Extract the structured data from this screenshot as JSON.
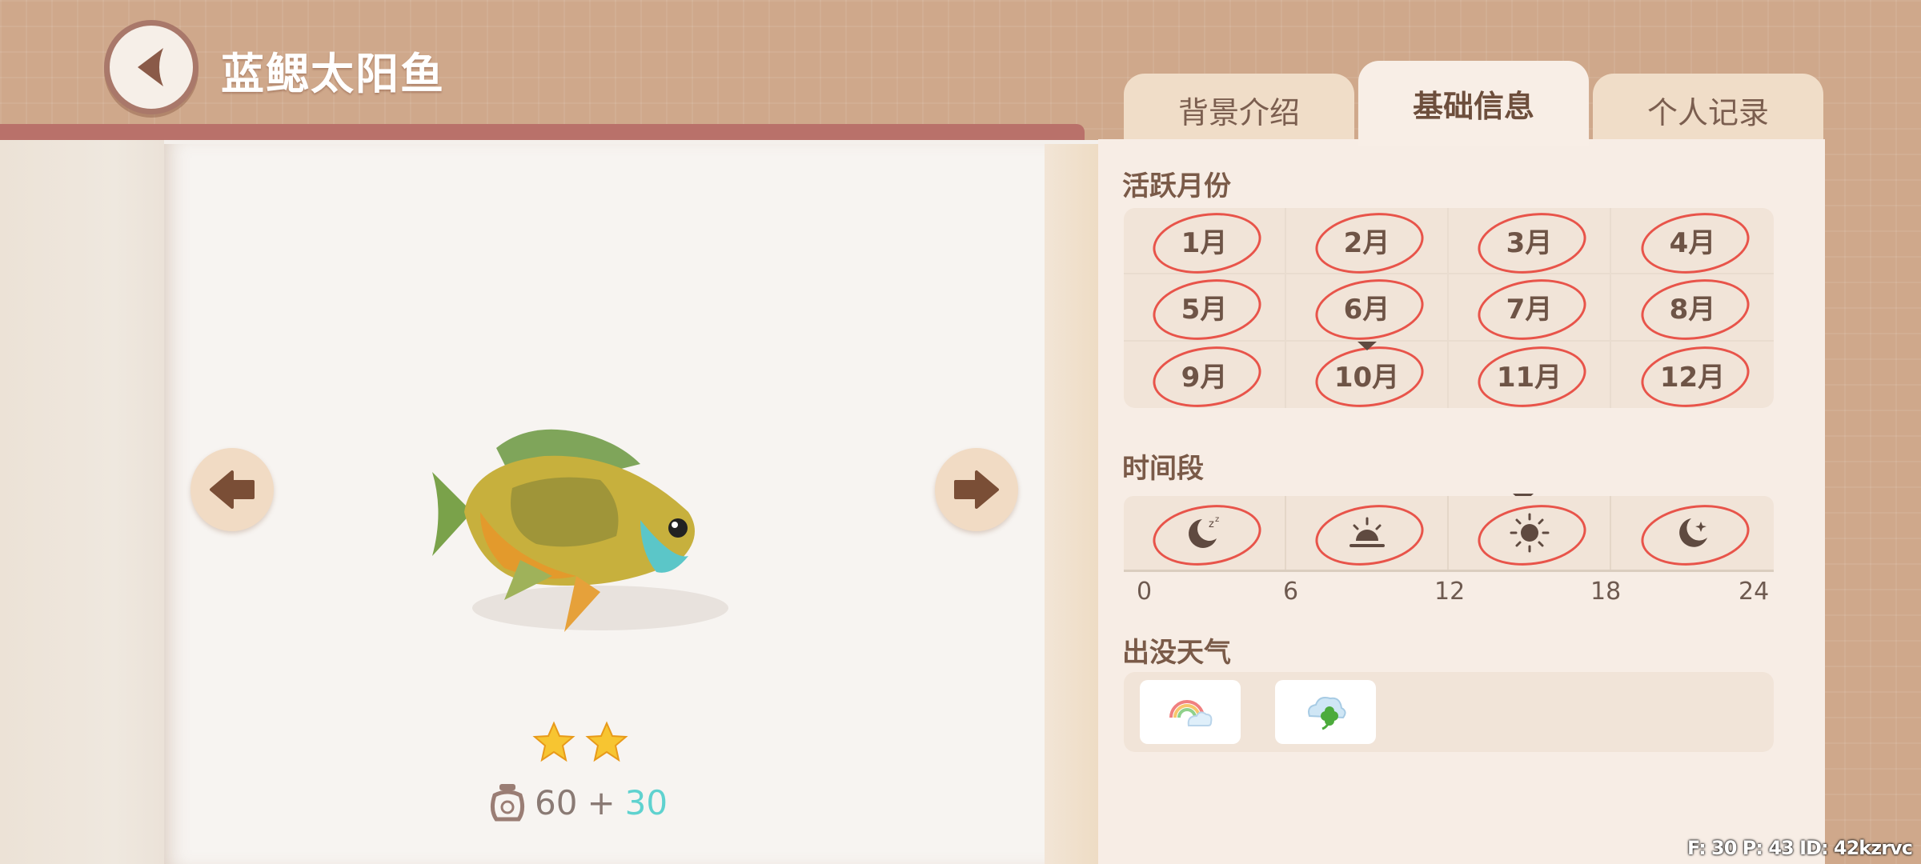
{
  "header": {
    "title": "蓝鳃太阳鱼"
  },
  "fish": {
    "stars": 2,
    "weight_base": "60",
    "weight_plus": "+",
    "weight_bonus": "30"
  },
  "tabs": [
    {
      "label": "背景介绍",
      "active": false
    },
    {
      "label": "基础信息",
      "active": true
    },
    {
      "label": "个人记录",
      "active": false
    }
  ],
  "months": {
    "title": "活跃月份",
    "items": [
      "1月",
      "2月",
      "3月",
      "4月",
      "5月",
      "6月",
      "7月",
      "8月",
      "9月",
      "10月",
      "11月",
      "12月"
    ],
    "current": "10月"
  },
  "time": {
    "title": "时间段",
    "slots": [
      {
        "icon": "sleep-moon-icon"
      },
      {
        "icon": "sunrise-icon"
      },
      {
        "icon": "sun-icon",
        "current": true
      },
      {
        "icon": "moon-star-icon"
      }
    ],
    "ticks": [
      "0",
      "6",
      "12",
      "18",
      "24"
    ]
  },
  "weather": {
    "title": "出没天气",
    "items": [
      {
        "icon": "rainbow-cloud-icon"
      },
      {
        "icon": "clover-cloud-icon"
      }
    ]
  },
  "debug": {
    "text": "F: 30   P: 43   ID: 42kzrvc"
  },
  "colors": {
    "circle": "#e8544a",
    "accent_bonus": "#5fd2cf",
    "tab_active": "#f8eee6"
  }
}
